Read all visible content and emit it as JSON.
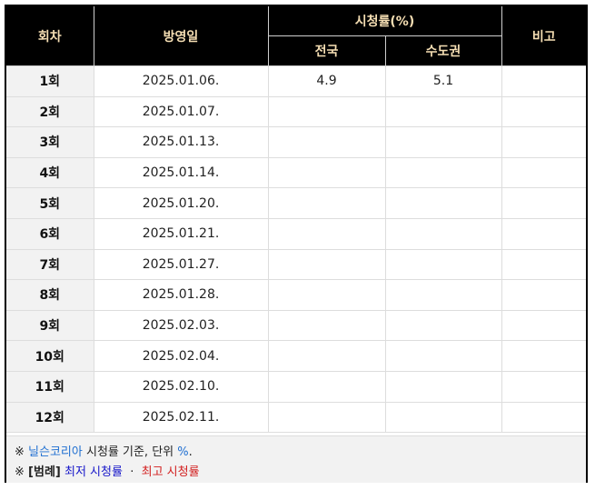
{
  "header": {
    "episode": "회차",
    "air_date": "방영일",
    "ratings": "시청률(%)",
    "nationwide": "전국",
    "capital": "수도권",
    "note": "비고"
  },
  "rows": [
    {
      "ep": "1회",
      "date": "2025.01.06.",
      "nationwide": "4.9",
      "capital": "5.1",
      "note": ""
    },
    {
      "ep": "2회",
      "date": "2025.01.07.",
      "nationwide": "",
      "capital": "",
      "note": ""
    },
    {
      "ep": "3회",
      "date": "2025.01.13.",
      "nationwide": "",
      "capital": "",
      "note": ""
    },
    {
      "ep": "4회",
      "date": "2025.01.14.",
      "nationwide": "",
      "capital": "",
      "note": ""
    },
    {
      "ep": "5회",
      "date": "2025.01.20.",
      "nationwide": "",
      "capital": "",
      "note": ""
    },
    {
      "ep": "6회",
      "date": "2025.01.21.",
      "nationwide": "",
      "capital": "",
      "note": ""
    },
    {
      "ep": "7회",
      "date": "2025.01.27.",
      "nationwide": "",
      "capital": "",
      "note": ""
    },
    {
      "ep": "8회",
      "date": "2025.01.28.",
      "nationwide": "",
      "capital": "",
      "note": ""
    },
    {
      "ep": "9회",
      "date": "2025.02.03.",
      "nationwide": "",
      "capital": "",
      "note": ""
    },
    {
      "ep": "10회",
      "date": "2025.02.04.",
      "nationwide": "",
      "capital": "",
      "note": ""
    },
    {
      "ep": "11회",
      "date": "2025.02.10.",
      "nationwide": "",
      "capital": "",
      "note": ""
    },
    {
      "ep": "12회",
      "date": "2025.02.11.",
      "nationwide": "",
      "capital": "",
      "note": ""
    }
  ],
  "legend": {
    "mark": "※",
    "source_link": "닐슨코리아",
    "basis_text": "시청률 기준, 단위",
    "unit": "%",
    "period": ".",
    "legend_label": "[범례]",
    "lowest": "최저 시청률",
    "separator": "·",
    "highest": "최고 시청률"
  },
  "colors": {
    "header_bg": "#000000",
    "header_text": "#f5deb3",
    "link": "#1f6fd1",
    "lowest": "#1515c9",
    "highest": "#d21d1d"
  }
}
